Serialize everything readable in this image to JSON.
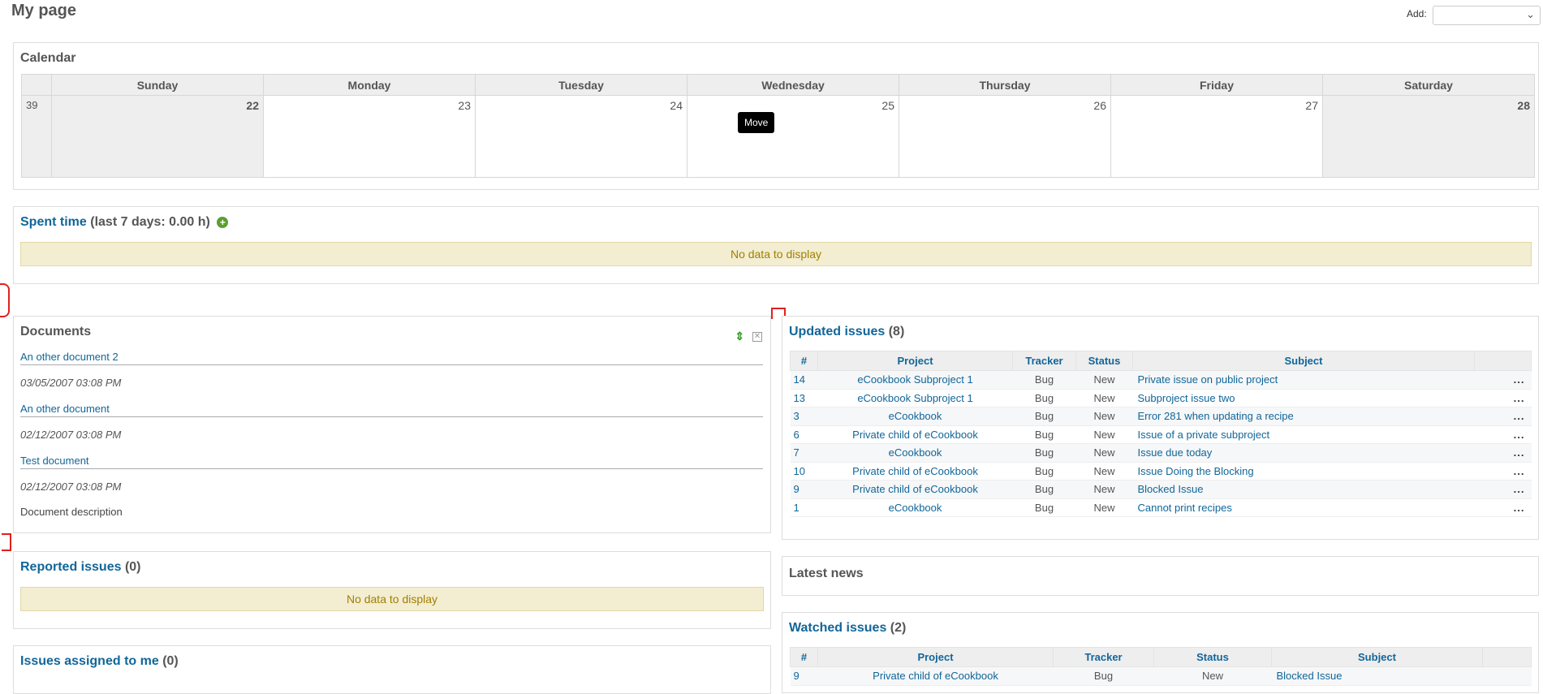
{
  "page": {
    "title": "My page"
  },
  "add": {
    "label": "Add:",
    "selected": ""
  },
  "calendar": {
    "title": "Calendar",
    "days": [
      "Sunday",
      "Monday",
      "Tuesday",
      "Wednesday",
      "Thursday",
      "Friday",
      "Saturday"
    ],
    "week_number": "39",
    "dates": [
      "22",
      "23",
      "24",
      "25",
      "26",
      "27",
      "28"
    ],
    "tooltip": "Move"
  },
  "spent_time": {
    "title": "Spent time",
    "subtitle": "(last 7 days: 0.00 h)",
    "empty": "No data to display"
  },
  "documents": {
    "title": "Documents",
    "items": [
      {
        "title": "An other document 2",
        "date": "03/05/2007 03:08 PM",
        "description": ""
      },
      {
        "title": "An other document",
        "date": "02/12/2007 03:08 PM",
        "description": ""
      },
      {
        "title": "Test document",
        "date": "02/12/2007 03:08 PM",
        "description": "Document description"
      }
    ]
  },
  "reported_issues": {
    "title": "Reported issues",
    "count": "(0)",
    "empty": "No data to display"
  },
  "assigned_issues": {
    "title": "Issues assigned to me",
    "count": "(0)"
  },
  "updated_issues": {
    "title": "Updated issues",
    "count": "(8)",
    "columns": [
      "#",
      "Project",
      "Tracker",
      "Status",
      "Subject"
    ],
    "rows": [
      {
        "id": "14",
        "project": "eCookbook Subproject 1",
        "tracker": "Bug",
        "status": "New",
        "subject": "Private issue on public project"
      },
      {
        "id": "13",
        "project": "eCookbook Subproject 1",
        "tracker": "Bug",
        "status": "New",
        "subject": "Subproject issue two"
      },
      {
        "id": "3",
        "project": "eCookbook",
        "tracker": "Bug",
        "status": "New",
        "subject": "Error 281 when updating a recipe"
      },
      {
        "id": "6",
        "project": "Private child of eCookbook",
        "tracker": "Bug",
        "status": "New",
        "subject": "Issue of a private subproject"
      },
      {
        "id": "7",
        "project": "eCookbook",
        "tracker": "Bug",
        "status": "New",
        "subject": "Issue due today"
      },
      {
        "id": "10",
        "project": "Private child of eCookbook",
        "tracker": "Bug",
        "status": "New",
        "subject": "Issue Doing the Blocking"
      },
      {
        "id": "9",
        "project": "Private child of eCookbook",
        "tracker": "Bug",
        "status": "New",
        "subject": "Blocked Issue"
      },
      {
        "id": "1",
        "project": "eCookbook",
        "tracker": "Bug",
        "status": "New",
        "subject": "Cannot print recipes"
      }
    ],
    "actions": "..."
  },
  "latest_news": {
    "title": "Latest news"
  },
  "watched_issues": {
    "title": "Watched issues",
    "count": "(2)",
    "columns": [
      "#",
      "Project",
      "Tracker",
      "Status",
      "Subject"
    ],
    "rows": [
      {
        "id": "9",
        "project": "Private child of eCookbook",
        "tracker": "Bug",
        "status": "New",
        "subject": "Blocked Issue"
      }
    ]
  },
  "colors": {
    "link": "#116699",
    "nodata_bg": "#f3edd1",
    "header_bg": "#eeeeee",
    "drop_marker": "#e02020"
  }
}
